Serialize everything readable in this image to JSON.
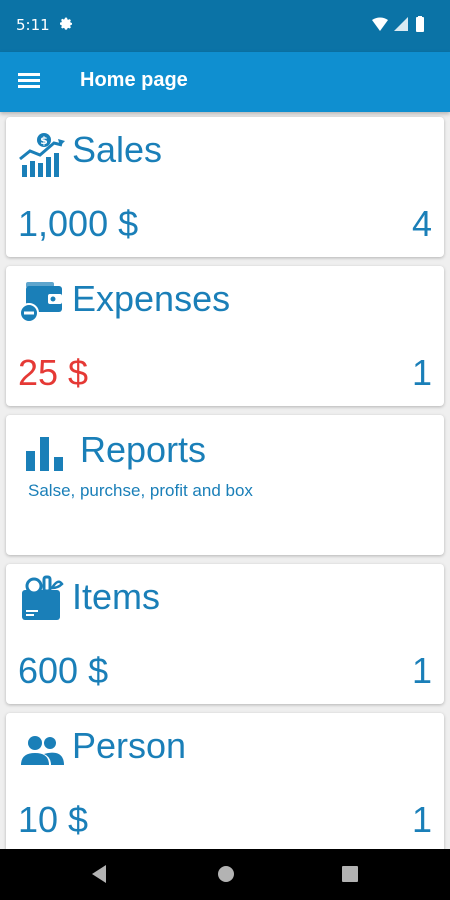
{
  "status_bar": {
    "time": "5:11"
  },
  "app_bar": {
    "title": "Home page"
  },
  "colors": {
    "accent": "#1a7fb8",
    "expense": "#e53935",
    "app_bar": "#0f8fd0",
    "status_bar": "#0b73a6"
  },
  "cards": {
    "sales": {
      "title": "Sales",
      "amount": "1,000 $",
      "count": "4",
      "icon": "sales-chart-icon"
    },
    "expenses": {
      "title": "Expenses",
      "amount": "25 $",
      "count": "1",
      "icon": "wallet-icon"
    },
    "reports": {
      "title": "Reports",
      "subtitle": "Salse, purchse, profit and box",
      "icon": "bar-chart-icon"
    },
    "items": {
      "title": "Items",
      "amount": "600 $",
      "count": "1",
      "icon": "grocery-bag-icon"
    },
    "person": {
      "title": "Person",
      "amount": "10 $",
      "count": "1",
      "icon": "people-icon"
    }
  }
}
